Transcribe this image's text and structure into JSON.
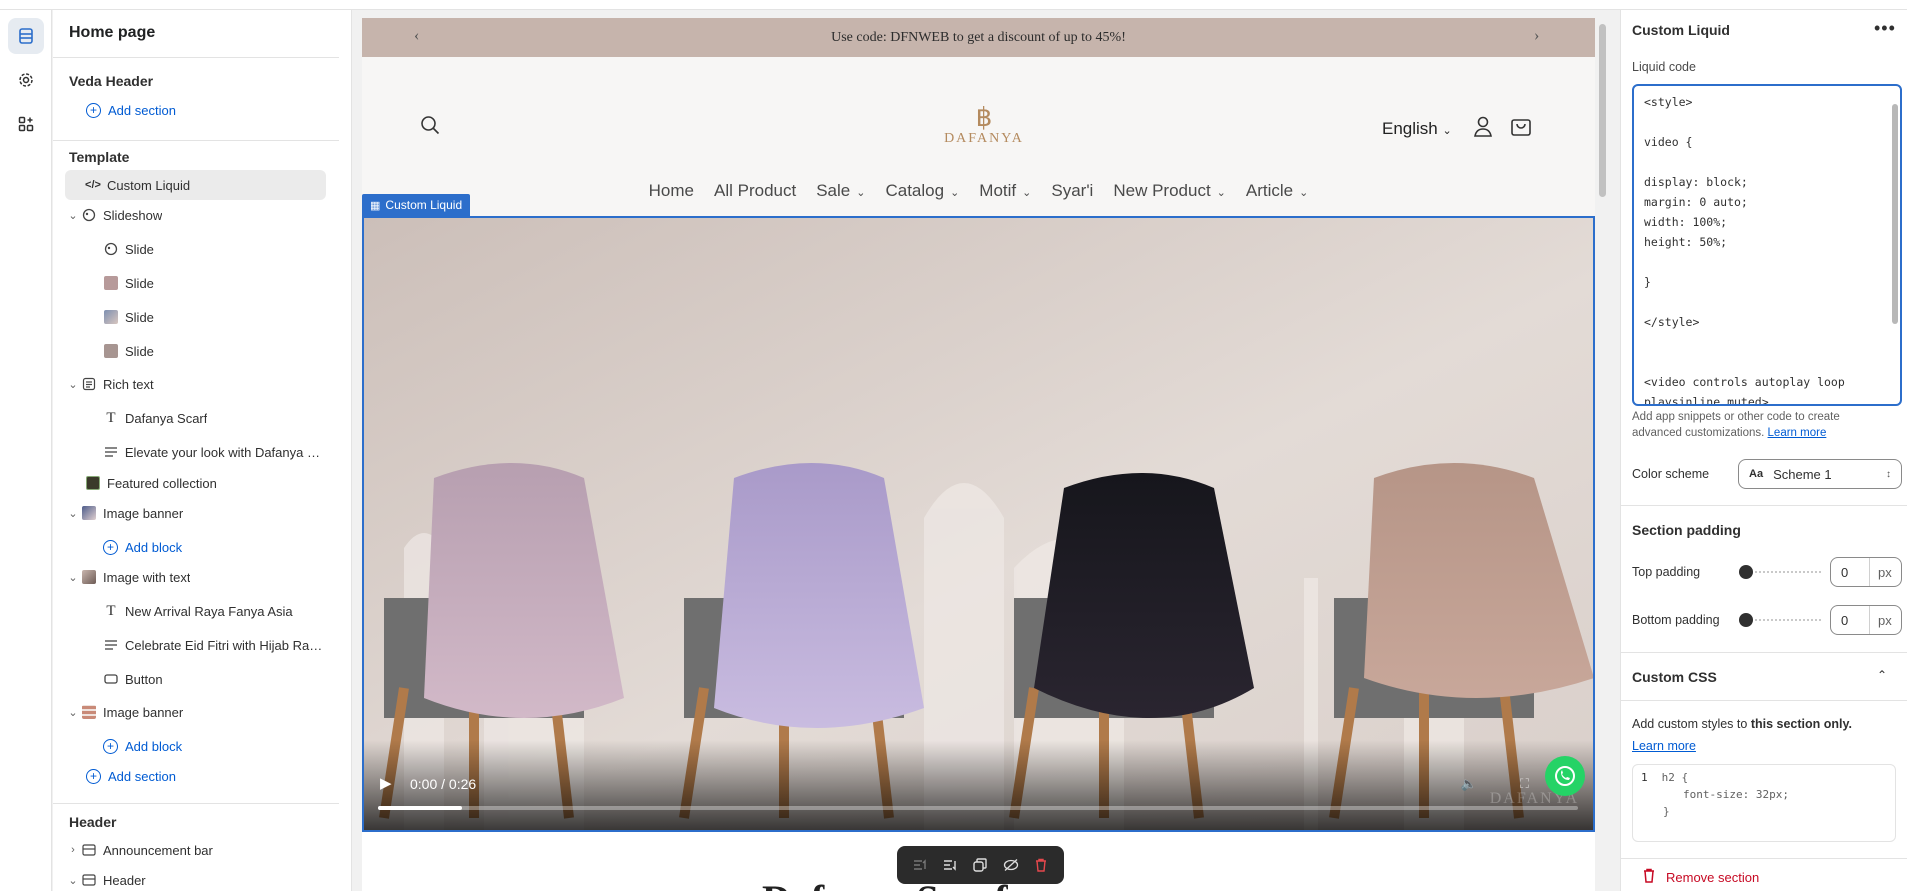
{
  "rail": {
    "items": [
      {
        "name": "sections-icon",
        "active": true
      },
      {
        "name": "gear-icon",
        "active": false
      },
      {
        "name": "apps-icon",
        "active": false
      }
    ]
  },
  "sidebar": {
    "title": "Home page",
    "veda_header": "Veda Header",
    "add_section": "Add section",
    "template_heading": "Template",
    "custom_liquid": "Custom Liquid",
    "slideshow": "Slideshow",
    "slide": "Slide",
    "rich_text": "Rich text",
    "dafanya_scarf": "Dafanya Scarf",
    "elevate_text": "Elevate your look with Dafanya S...",
    "featured_collection": "Featured collection",
    "image_banner": "Image banner",
    "add_block": "Add block",
    "image_with_text": "Image with text",
    "new_arrival": "New Arrival Raya Fanya Asia",
    "celebrate": "Celebrate Eid Fitri with Hijab Ray...",
    "button": "Button",
    "header_heading": "Header",
    "announcement_bar": "Announcement bar",
    "header_item": "Header"
  },
  "preview": {
    "announcement": "Use code: DFNWEB to get a discount of up to 45%!",
    "logo_text": "DAFANYA",
    "language": "English",
    "nav": [
      {
        "label": "Home",
        "dropdown": false
      },
      {
        "label": "All Product",
        "dropdown": false
      },
      {
        "label": "Sale",
        "dropdown": true
      },
      {
        "label": "Catalog",
        "dropdown": true
      },
      {
        "label": "Motif",
        "dropdown": true
      },
      {
        "label": "Syar'i",
        "dropdown": false
      },
      {
        "label": "New Product",
        "dropdown": true
      },
      {
        "label": "Article",
        "dropdown": true
      }
    ],
    "section_tag": "Custom Liquid",
    "video_time": "0:00 / 0:26",
    "video_progress": 0.07,
    "video_watermark": "DAFANYA",
    "below_heading": "Dafanya Scarf"
  },
  "panel": {
    "title": "Custom Liquid",
    "more": "•••",
    "liquid_label": "Liquid code",
    "liquid_code": "<style>\n\nvideo {\n\ndisplay: block;\nmargin: 0 auto;\nwidth: 100%;\nheight: 50%;\n\n}\n\n</style>\n\n\n<video controls autoplay loop\nplaysinline muted>",
    "help_text": "Add app snippets or other code to create advanced customizations.",
    "learn_more": "Learn more",
    "color_scheme_label": "Color scheme",
    "color_scheme_swatch": "Aa",
    "color_scheme_value": "Scheme 1",
    "section_padding": "Section padding",
    "top_padding_label": "Top padding",
    "top_padding_value": "0",
    "bottom_padding_label": "Bottom padding",
    "bottom_padding_value": "0",
    "unit": "px",
    "custom_css": "Custom CSS",
    "css_help_prefix": "Add custom styles to ",
    "css_help_bold": "this section only.",
    "css_learn_more": "Learn more",
    "css_line_number": "1",
    "css_placeholder_1": "h2 {",
    "css_placeholder_2": "font-size: 32px;",
    "css_placeholder_3": "}",
    "remove_section": "Remove section"
  },
  "colors": {
    "accent": "#2c6ecb",
    "link": "#005bd3",
    "danger": "#c70a24",
    "announcement_bg": "#c6b4ac",
    "logo": "#b48a5e"
  }
}
